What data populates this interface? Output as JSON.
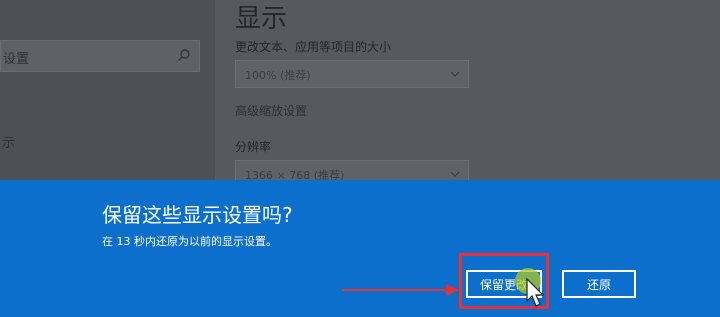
{
  "sidebar": {
    "search_text": "设置",
    "item_partial": "示"
  },
  "main": {
    "title": "显示",
    "scale_label": "更改文本、应用等项目的大小",
    "scale_value": "100% (推荐)",
    "advanced_link": "高级缩放设置",
    "resolution_label": "分辨率",
    "resolution_value": "1366 × 768 (推荐)"
  },
  "dialog": {
    "title": "保留这些显示设置吗?",
    "subtitle": "在 13 秒内还原为以前的显示设置。",
    "keep_button": "保留更改",
    "revert_button": "还原"
  },
  "colors": {
    "dialog_bg": "#0d6fcc",
    "highlight": "#e4313b"
  },
  "icons": {
    "search": "search-icon",
    "chevron": "chevron-down-icon",
    "cursor": "mouse-cursor-icon",
    "arrow": "red-arrow-annotation"
  }
}
